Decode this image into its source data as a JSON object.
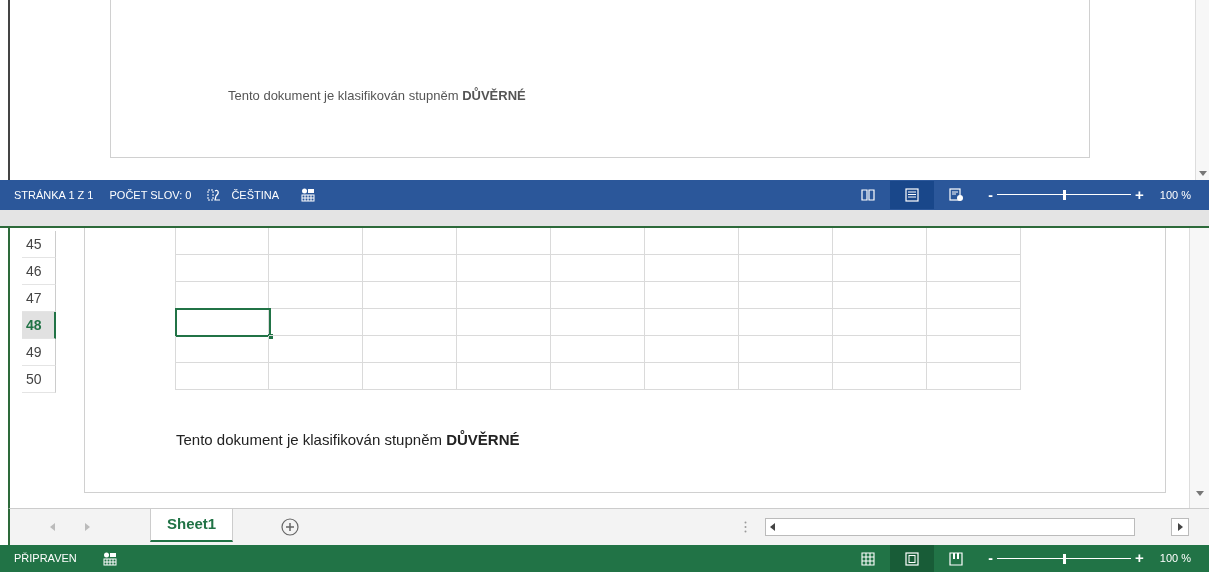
{
  "word": {
    "document_text": "Tento dokument je klasifikován stupněm **DŮVĚRNÉ**",
    "status_bar": {
      "items": [
        "STRÁNKA 1 Z 1",
        "POČET SLOV: 0"
      ],
      "language": "ČEŠTINA",
      "views": [
        {
          "kind": "read",
          "selected": false
        },
        {
          "kind": "print",
          "selected": true
        },
        {
          "kind": "web",
          "selected": false
        }
      ],
      "zoom": {
        "minus": "-",
        "plus": "+",
        "level": 0.5,
        "reading": "100 %"
      }
    }
  },
  "excel": {
    "rows": [
      {
        "label": "45",
        "selected": false
      },
      {
        "label": "46",
        "selected": false
      },
      {
        "label": "47",
        "selected": false
      },
      {
        "label": "48",
        "selected": true
      },
      {
        "label": "49",
        "selected": false
      },
      {
        "label": "50",
        "selected": false
      }
    ],
    "document_text": "Tento dokument je klasifikován stupněm **DŮVĚRNÉ**",
    "sheet_tabs": [
      {
        "label": "Sheet1",
        "selected": true
      }
    ],
    "status_bar": {
      "status": "PŘIPRAVEN",
      "views": [
        {
          "kind": "normal",
          "selected": false
        },
        {
          "kind": "layout",
          "selected": true
        },
        {
          "kind": "break",
          "selected": false
        }
      ],
      "zoom": {
        "minus": "-",
        "plus": "+",
        "level": 0.5,
        "reading": "100 %"
      }
    }
  }
}
